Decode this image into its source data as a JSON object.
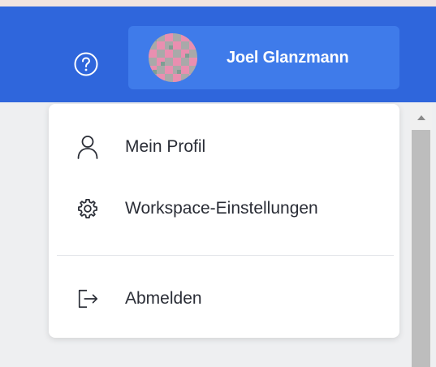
{
  "header": {
    "help_icon": "question-circle-icon",
    "user_name": "Joel Glanzmann",
    "colors": {
      "header_bg": "#2f66dc",
      "user_button_bg": "#3f7bea"
    }
  },
  "menu": {
    "items": [
      {
        "label": "Mein Profil",
        "icon": "user-icon"
      },
      {
        "label": "Workspace-Einstellungen",
        "icon": "gear-icon"
      },
      {
        "label": "Abmelden",
        "icon": "logout-icon"
      }
    ]
  }
}
